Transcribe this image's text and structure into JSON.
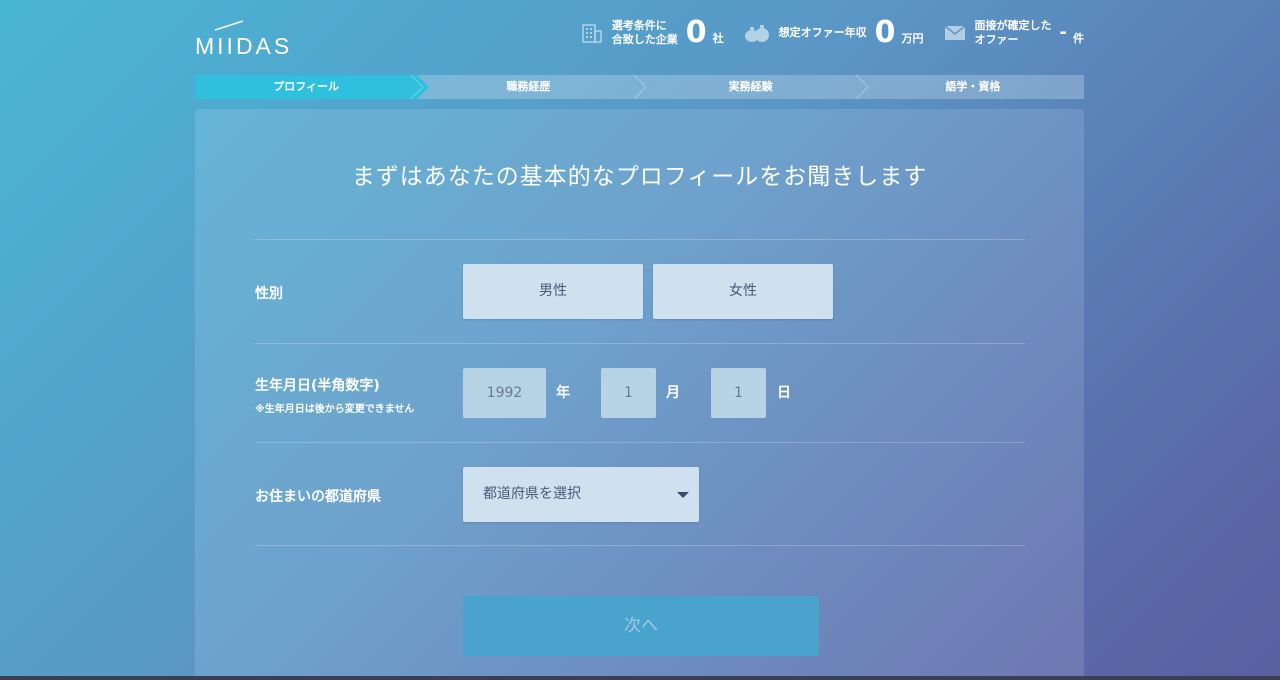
{
  "header": {
    "logo_text": "MIIDAS",
    "stats": [
      {
        "label_line1": "選考条件に",
        "label_line2": "合致した企業",
        "value": "0",
        "unit": "社",
        "icon": "building-icon"
      },
      {
        "label_line1": "想定オファー年収",
        "label_line2": "",
        "value": "0",
        "unit": "万円",
        "icon": "money-bags-icon"
      },
      {
        "label_line1": "面接が確定した",
        "label_line2": "オファー",
        "value": "-",
        "unit": "件",
        "icon": "mail-icon"
      }
    ]
  },
  "steps": [
    "プロフィール",
    "職務経歴",
    "実務経験",
    "語学・資格"
  ],
  "card": {
    "title": "まずはあなたの基本的なプロフィールをお聞きします",
    "gender": {
      "label": "性別",
      "options": [
        "男性",
        "女性"
      ]
    },
    "birthdate": {
      "label": "生年月日(半角数字)",
      "note": "※生年月日は後から変更できません",
      "year_placeholder": "1992",
      "year_unit": "年",
      "month_placeholder": "1",
      "month_unit": "月",
      "day_placeholder": "1",
      "day_unit": "日"
    },
    "prefecture": {
      "label": "お住まいの都道府県",
      "placeholder": "都道府県を選択"
    },
    "next_label": "次へ"
  },
  "colors": {
    "active_step": "#2fc0de",
    "choice_bg": "#cfe0ee",
    "next_button": "#4aa3cd"
  }
}
